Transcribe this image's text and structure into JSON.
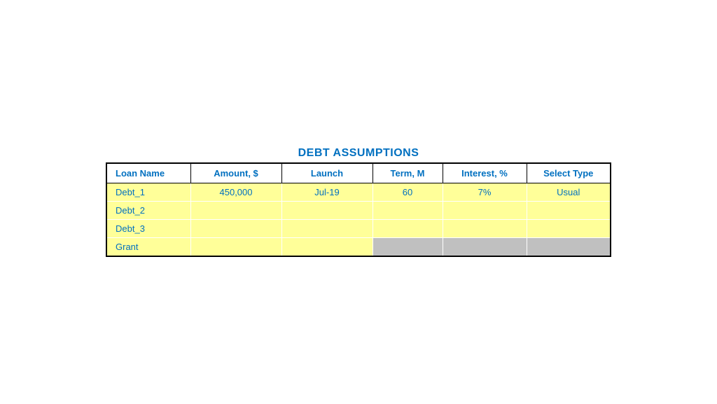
{
  "title": "DEBT ASSUMPTIONS",
  "table": {
    "headers": [
      "Loan Name",
      "Amount, $",
      "Launch",
      "Term, M",
      "Interest, %",
      "Select Type"
    ],
    "rows": [
      {
        "loan_name": "Debt_1",
        "amount": "450,000",
        "launch": "Jul-19",
        "term": "60",
        "interest": "7%",
        "select_type": "Usual",
        "grey_cells": []
      },
      {
        "loan_name": "Debt_2",
        "amount": "",
        "launch": "",
        "term": "",
        "interest": "",
        "select_type": "",
        "grey_cells": []
      },
      {
        "loan_name": "Debt_3",
        "amount": "",
        "launch": "",
        "term": "",
        "interest": "",
        "select_type": "",
        "grey_cells": []
      },
      {
        "loan_name": "Grant",
        "amount": "",
        "launch": "",
        "term": "",
        "interest": "",
        "select_type": "",
        "grey_cells": [
          "term",
          "interest",
          "select_type"
        ]
      }
    ]
  },
  "colors": {
    "header_text": "#0070C0",
    "cell_bg": "#FFFF99",
    "grey_cell_bg": "#C0C0C0",
    "border": "#000000",
    "title": "#0070C0"
  }
}
